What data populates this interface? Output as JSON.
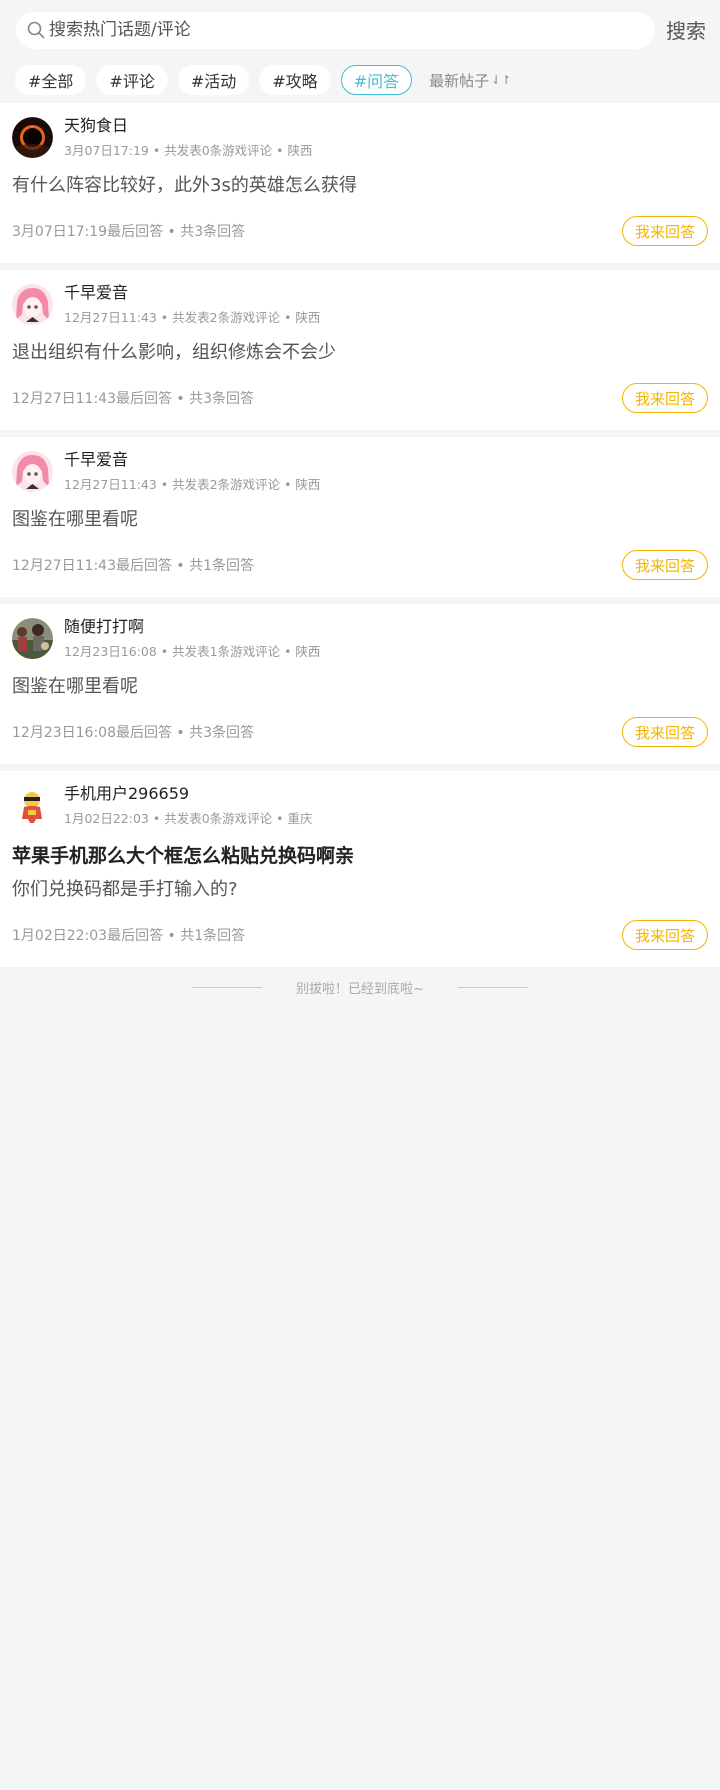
{
  "search": {
    "placeholder": "搜索热门话题/评论",
    "button_label": "搜索"
  },
  "tags": [
    "#全部",
    "#评论",
    "#活动",
    "#攻略",
    "#问答"
  ],
  "active_tag": "#问答",
  "sort": {
    "label": "最新帖子",
    "icon": "sort-arrows-icon"
  },
  "posts": [
    {
      "user": "天狗食日",
      "meta": "3月07日17:19 • 共发表0条游戏评论 • 陕西",
      "title": "",
      "text": "有什么阵容比较好，此外3s的英雄怎么获得",
      "foot": "3月07日17:19最后回答 • 共3条回答",
      "button": "我来回答",
      "avatar": "eclipse-avatar"
    },
    {
      "user": "千早爱音",
      "meta": "12月27日11:43 • 共发表2条游戏评论 • 陕西",
      "title": "",
      "text": "退出组织有什么影响，组织修炼会不会少",
      "foot": "12月27日11:43最后回答 • 共3条回答",
      "button": "我来回答",
      "avatar": "anime-girl-avatar"
    },
    {
      "user": "千早爱音",
      "meta": "12月27日11:43 • 共发表2条游戏评论 • 陕西",
      "title": "",
      "text": "图鉴在哪里看呢",
      "foot": "12月27日11:43最后回答 • 共1条回答",
      "button": "我来回答",
      "avatar": "anime-girl-avatar"
    },
    {
      "user": "随便打打啊",
      "meta": "12月23日16:08 • 共发表1条游戏评论 • 陕西",
      "title": "",
      "text": "图鉴在哪里看呢",
      "foot": "12月23日16:08最后回答 • 共3条回答",
      "button": "我来回答",
      "avatar": "photo-avatar"
    },
    {
      "user": "手机用户296659",
      "meta": "1月02日22:03 • 共发表0条游戏评论 • 重庆",
      "title": "苹果手机那么大个框怎么粘贴兑换码啊亲",
      "text": "你们兑换码都是手打输入的?",
      "foot": "1月02日22:03最后回答 • 共1条回答",
      "button": "我来回答",
      "avatar": "cartoon-avatar"
    }
  ],
  "end_text": "别拔啦！已经到底啦~",
  "colors": {
    "accent": "#3fbfd6",
    "answer": "#f5b400",
    "background": "#f4f5f7"
  }
}
